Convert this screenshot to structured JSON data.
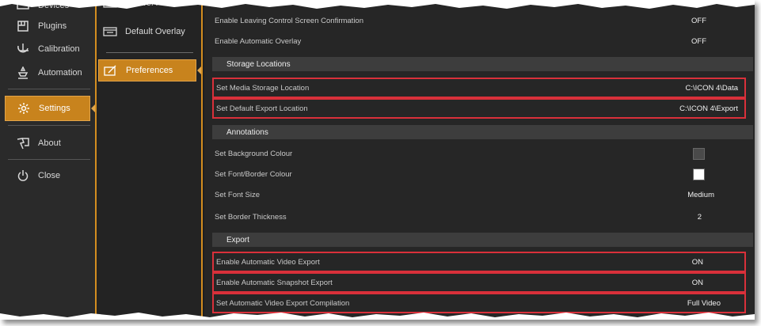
{
  "nav": {
    "items": [
      {
        "label": "Devices",
        "icon": "devices-icon"
      },
      {
        "label": "Plugins",
        "icon": "plugins-icon"
      },
      {
        "label": "Calibration",
        "icon": "calibration-icon"
      },
      {
        "label": "Automation",
        "icon": "automation-icon"
      },
      {
        "label": "Settings",
        "icon": "gear-icon",
        "active": true
      },
      {
        "label": "About",
        "icon": "about-icon"
      },
      {
        "label": "Close",
        "icon": "power-icon"
      }
    ]
  },
  "subnav": {
    "items": [
      {
        "label": "Control Panel",
        "icon": "control-panel-icon"
      },
      {
        "label": "Default Overlay",
        "icon": "overlay-icon"
      },
      {
        "label": "Preferences",
        "icon": "preferences-icon",
        "active": true
      }
    ]
  },
  "settings": {
    "rows_top": [
      {
        "label": "Enable Leaving Control Screen Confirmation",
        "value": "OFF"
      },
      {
        "label": "Enable Automatic Overlay",
        "value": "OFF"
      }
    ],
    "storage": {
      "title": "Storage Locations",
      "rows": [
        {
          "label": "Set Media Storage Location",
          "value": "C:\\ICON 4\\Data"
        },
        {
          "label": "Set Default Export Location",
          "value": "C:\\ICON 4\\Export"
        }
      ]
    },
    "annotations": {
      "title": "Annotations",
      "rows": [
        {
          "label": "Set Background Colour",
          "swatch": "#4a4a4a"
        },
        {
          "label": "Set Font/Border Colour",
          "swatch": "#ffffff"
        },
        {
          "label": "Set Font Size",
          "value": "Medium"
        },
        {
          "label": "Set Border Thickness",
          "value": "2"
        }
      ]
    },
    "export": {
      "title": "Export",
      "rows": [
        {
          "label": "Enable Automatic Video Export",
          "value": "ON"
        },
        {
          "label": "Enable Automatic Snapshot Export",
          "value": "ON"
        },
        {
          "label": "Set Automatic Video Export Compilation",
          "value": "Full Video"
        }
      ]
    }
  },
  "colors": {
    "accent": "#c8831d",
    "highlight_border": "#d9303a",
    "background": "#262626"
  }
}
